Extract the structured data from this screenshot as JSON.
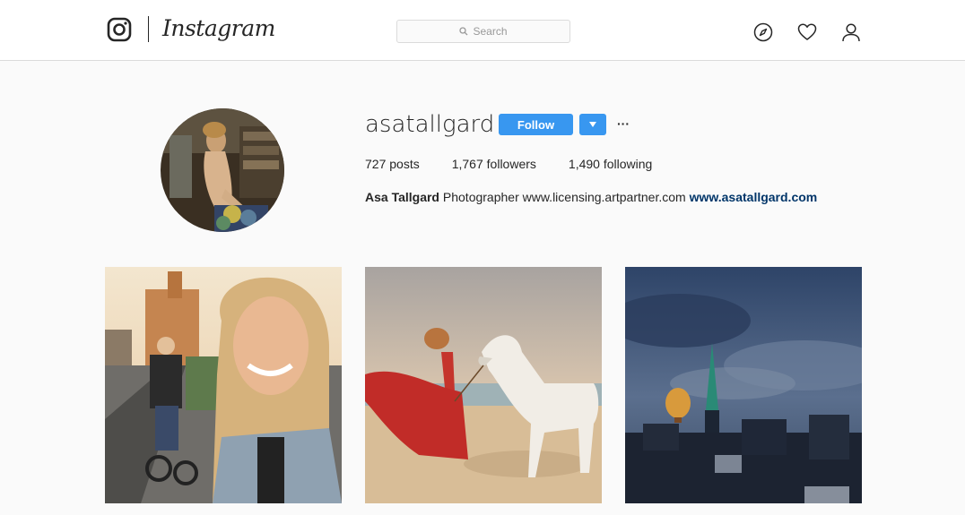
{
  "nav": {
    "logo_text": "Instagram",
    "search_placeholder": "Search",
    "icons": [
      "camera-logo-icon",
      "compass-icon",
      "heart-icon",
      "person-icon"
    ]
  },
  "profile": {
    "username": "asatallgard",
    "follow_label": "Follow",
    "dropdown_glyph": "▾",
    "more_glyph": "···",
    "stats": {
      "posts_count": "727",
      "posts_label": "posts",
      "followers_count": "1,767",
      "followers_label": "followers",
      "following_count": "1,490",
      "following_label": "following"
    },
    "bio": {
      "full_name": "Asa Tallgard",
      "text": "Photographer www.licensing.artpartner.com",
      "link": "www.asatallgard.com"
    }
  },
  "colors": {
    "accent": "#3897f0",
    "link": "#003569",
    "border": "#dbdbdb",
    "background": "#fafafa"
  }
}
